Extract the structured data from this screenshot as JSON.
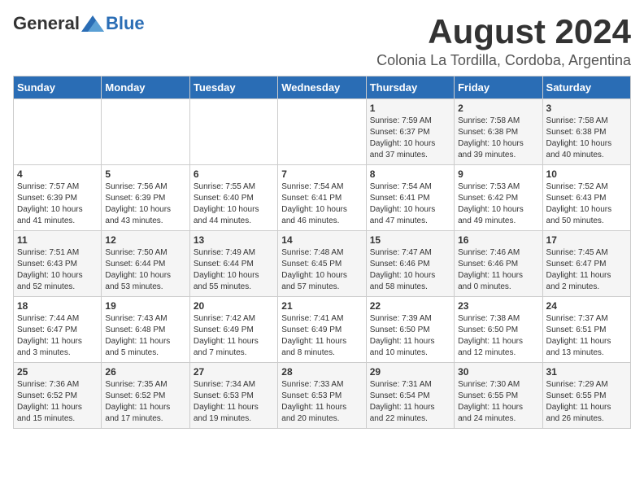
{
  "logo": {
    "general": "General",
    "blue": "Blue"
  },
  "header": {
    "title": "August 2024",
    "location": "Colonia La Tordilla, Cordoba, Argentina"
  },
  "weekdays": [
    "Sunday",
    "Monday",
    "Tuesday",
    "Wednesday",
    "Thursday",
    "Friday",
    "Saturday"
  ],
  "weeks": [
    [
      {
        "day": "",
        "info": ""
      },
      {
        "day": "",
        "info": ""
      },
      {
        "day": "",
        "info": ""
      },
      {
        "day": "",
        "info": ""
      },
      {
        "day": "1",
        "info": "Sunrise: 7:59 AM\nSunset: 6:37 PM\nDaylight: 10 hours\nand 37 minutes."
      },
      {
        "day": "2",
        "info": "Sunrise: 7:58 AM\nSunset: 6:38 PM\nDaylight: 10 hours\nand 39 minutes."
      },
      {
        "day": "3",
        "info": "Sunrise: 7:58 AM\nSunset: 6:38 PM\nDaylight: 10 hours\nand 40 minutes."
      }
    ],
    [
      {
        "day": "4",
        "info": "Sunrise: 7:57 AM\nSunset: 6:39 PM\nDaylight: 10 hours\nand 41 minutes."
      },
      {
        "day": "5",
        "info": "Sunrise: 7:56 AM\nSunset: 6:39 PM\nDaylight: 10 hours\nand 43 minutes."
      },
      {
        "day": "6",
        "info": "Sunrise: 7:55 AM\nSunset: 6:40 PM\nDaylight: 10 hours\nand 44 minutes."
      },
      {
        "day": "7",
        "info": "Sunrise: 7:54 AM\nSunset: 6:41 PM\nDaylight: 10 hours\nand 46 minutes."
      },
      {
        "day": "8",
        "info": "Sunrise: 7:54 AM\nSunset: 6:41 PM\nDaylight: 10 hours\nand 47 minutes."
      },
      {
        "day": "9",
        "info": "Sunrise: 7:53 AM\nSunset: 6:42 PM\nDaylight: 10 hours\nand 49 minutes."
      },
      {
        "day": "10",
        "info": "Sunrise: 7:52 AM\nSunset: 6:43 PM\nDaylight: 10 hours\nand 50 minutes."
      }
    ],
    [
      {
        "day": "11",
        "info": "Sunrise: 7:51 AM\nSunset: 6:43 PM\nDaylight: 10 hours\nand 52 minutes."
      },
      {
        "day": "12",
        "info": "Sunrise: 7:50 AM\nSunset: 6:44 PM\nDaylight: 10 hours\nand 53 minutes."
      },
      {
        "day": "13",
        "info": "Sunrise: 7:49 AM\nSunset: 6:44 PM\nDaylight: 10 hours\nand 55 minutes."
      },
      {
        "day": "14",
        "info": "Sunrise: 7:48 AM\nSunset: 6:45 PM\nDaylight: 10 hours\nand 57 minutes."
      },
      {
        "day": "15",
        "info": "Sunrise: 7:47 AM\nSunset: 6:46 PM\nDaylight: 10 hours\nand 58 minutes."
      },
      {
        "day": "16",
        "info": "Sunrise: 7:46 AM\nSunset: 6:46 PM\nDaylight: 11 hours\nand 0 minutes."
      },
      {
        "day": "17",
        "info": "Sunrise: 7:45 AM\nSunset: 6:47 PM\nDaylight: 11 hours\nand 2 minutes."
      }
    ],
    [
      {
        "day": "18",
        "info": "Sunrise: 7:44 AM\nSunset: 6:47 PM\nDaylight: 11 hours\nand 3 minutes."
      },
      {
        "day": "19",
        "info": "Sunrise: 7:43 AM\nSunset: 6:48 PM\nDaylight: 11 hours\nand 5 minutes."
      },
      {
        "day": "20",
        "info": "Sunrise: 7:42 AM\nSunset: 6:49 PM\nDaylight: 11 hours\nand 7 minutes."
      },
      {
        "day": "21",
        "info": "Sunrise: 7:41 AM\nSunset: 6:49 PM\nDaylight: 11 hours\nand 8 minutes."
      },
      {
        "day": "22",
        "info": "Sunrise: 7:39 AM\nSunset: 6:50 PM\nDaylight: 11 hours\nand 10 minutes."
      },
      {
        "day": "23",
        "info": "Sunrise: 7:38 AM\nSunset: 6:50 PM\nDaylight: 11 hours\nand 12 minutes."
      },
      {
        "day": "24",
        "info": "Sunrise: 7:37 AM\nSunset: 6:51 PM\nDaylight: 11 hours\nand 13 minutes."
      }
    ],
    [
      {
        "day": "25",
        "info": "Sunrise: 7:36 AM\nSunset: 6:52 PM\nDaylight: 11 hours\nand 15 minutes."
      },
      {
        "day": "26",
        "info": "Sunrise: 7:35 AM\nSunset: 6:52 PM\nDaylight: 11 hours\nand 17 minutes."
      },
      {
        "day": "27",
        "info": "Sunrise: 7:34 AM\nSunset: 6:53 PM\nDaylight: 11 hours\nand 19 minutes."
      },
      {
        "day": "28",
        "info": "Sunrise: 7:33 AM\nSunset: 6:53 PM\nDaylight: 11 hours\nand 20 minutes."
      },
      {
        "day": "29",
        "info": "Sunrise: 7:31 AM\nSunset: 6:54 PM\nDaylight: 11 hours\nand 22 minutes."
      },
      {
        "day": "30",
        "info": "Sunrise: 7:30 AM\nSunset: 6:55 PM\nDaylight: 11 hours\nand 24 minutes."
      },
      {
        "day": "31",
        "info": "Sunrise: 7:29 AM\nSunset: 6:55 PM\nDaylight: 11 hours\nand 26 minutes."
      }
    ]
  ]
}
